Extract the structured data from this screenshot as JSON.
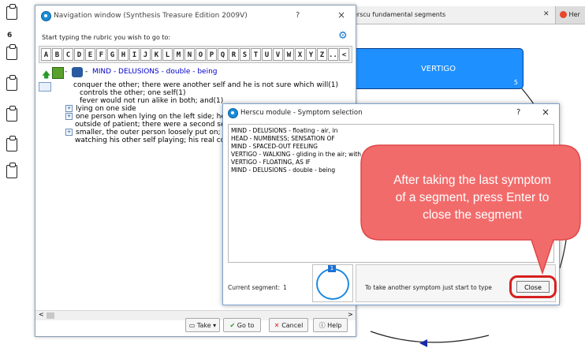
{
  "left_strip": {
    "count": "6"
  },
  "background": {
    "tab_title": "erscu fundamental segments",
    "tab2_title": "Her",
    "node_label": "VERTIGO",
    "node_count": "5"
  },
  "nav_window": {
    "title": "Navigation window (Synthesis Treasure Edition 2009V)",
    "help_btn": "?",
    "close_btn": "×",
    "prompt": "Start typing the rubric you wish to go to:",
    "alphabet": [
      "A",
      "B",
      "C",
      "D",
      "E",
      "F",
      "G",
      "H",
      "I",
      "J",
      "K",
      "L",
      "M",
      "N",
      "O",
      "P",
      "Q",
      "R",
      "S",
      "T",
      "U",
      "V",
      "W",
      "X",
      "Y",
      "Z",
      "...",
      "<"
    ],
    "rubric": "MIND - DELUSIONS - double - being",
    "tree": [
      "conquer the other; there were another self and he is not sure which will(1)",
      "controls the other; one self(1)",
      "fever would not run alike in both; and(1)",
      "lying on one side",
      "one person when lying on the left side; he w",
      "outside of patient; there were a second sel",
      "smaller, the outer person loosely put on; th",
      "watching his other self playing; his real con"
    ],
    "toolbar": {
      "take": "Take",
      "goto": "Go to",
      "cancel": "Cancel",
      "help": "Help"
    }
  },
  "dialog": {
    "title": "Herscu module - Symptom selection",
    "help_btn": "?",
    "close_x": "×",
    "symptoms": [
      "MIND - DELUSIONS - floating - air, in",
      "HEAD - NUMBNESS; SENSATION OF",
      "MIND - SPACED-OUT FEELING",
      "VERTIGO - WALKING - gliding in the air; with sensat",
      "VERTIGO - FLOATING, AS IF",
      "MIND - DELUSIONS - double - being"
    ],
    "current_segment_label": "Current segment:",
    "current_segment_value": "1",
    "segment_badge": "1",
    "hint": "To take another symptom just start to type",
    "close_label": "Close"
  },
  "callout": {
    "line1": "After taking the last symptom",
    "line2": "of a segment, press Enter to",
    "line3": "close the segment"
  }
}
